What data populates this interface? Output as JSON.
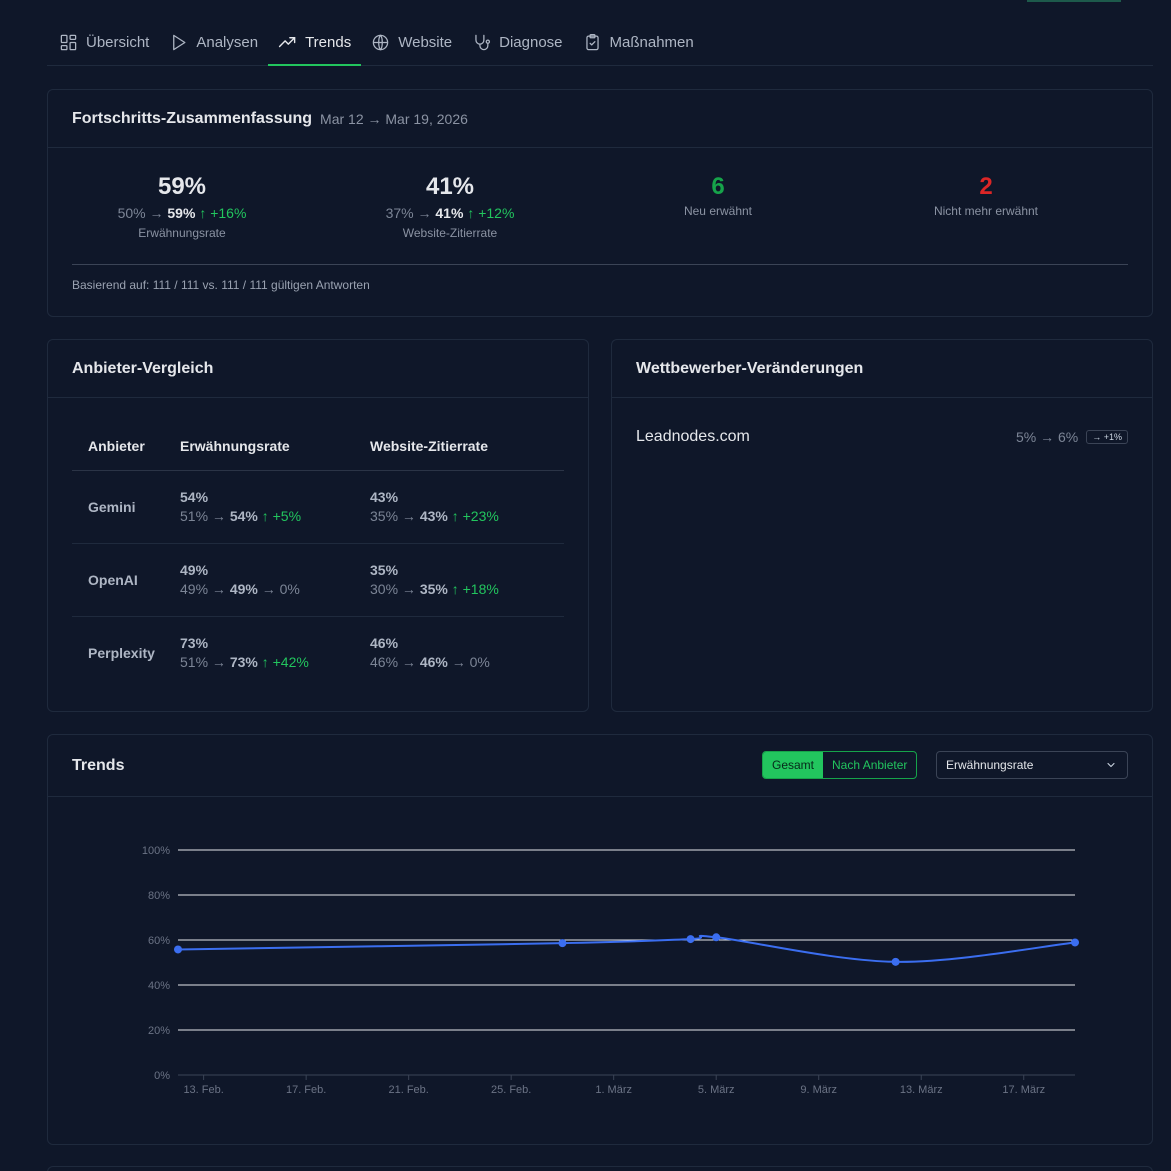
{
  "tabs": [
    {
      "label": "Übersicht",
      "icon": "dashboard-icon"
    },
    {
      "label": "Analysen",
      "icon": "play-icon"
    },
    {
      "label": "Trends",
      "icon": "trending-up-icon",
      "active": true
    },
    {
      "label": "Website",
      "icon": "globe-icon"
    },
    {
      "label": "Diagnose",
      "icon": "stethoscope-icon"
    },
    {
      "label": "Maßnahmen",
      "icon": "clipboard-check-icon"
    }
  ],
  "summary": {
    "title": "Fortschritts-Zusammenfassung",
    "range": "Mar 12 → Mar 19, 2026",
    "mention": {
      "value": "59%",
      "from": "50%",
      "to": "59%",
      "delta": "↑ +16%",
      "caption": "Erwähnungsrate"
    },
    "citation": {
      "value": "41%",
      "from": "37%",
      "to": "41%",
      "delta": "↑ +12%",
      "caption": "Website-Zitierrate"
    },
    "new_mentioned": {
      "value": "6",
      "caption": "Neu erwähnt"
    },
    "no_longer": {
      "value": "2",
      "caption": "Nicht mehr erwähnt"
    },
    "footnote": "Basierend auf: 111 / 111 vs. 111 / 111 gültigen Antworten"
  },
  "providers": {
    "title": "Anbieter-Vergleich",
    "headers": [
      "Anbieter",
      "Erwähnungsrate",
      "Website-Zitierrate"
    ],
    "rows": [
      {
        "name": "Gemini",
        "m": {
          "value": "54%",
          "from": "51%",
          "to": "54%",
          "delta": "↑ +5%"
        },
        "c": {
          "value": "43%",
          "from": "35%",
          "to": "43%",
          "delta": "↑ +23%"
        }
      },
      {
        "name": "OpenAI",
        "m": {
          "value": "49%",
          "from": "49%",
          "to": "49%",
          "delta": "→ 0%"
        },
        "c": {
          "value": "35%",
          "from": "30%",
          "to": "35%",
          "delta": "↑ +18%"
        }
      },
      {
        "name": "Perplexity",
        "m": {
          "value": "73%",
          "from": "51%",
          "to": "73%",
          "delta": "↑ +42%"
        },
        "c": {
          "value": "46%",
          "from": "46%",
          "to": "46%",
          "delta": "→ 0%"
        }
      }
    ]
  },
  "competitors": {
    "title": "Wettbewerber-Veränderungen",
    "items": [
      {
        "name": "Leadnodes.com",
        "change": "5% → 6%",
        "badge": "→ +1%"
      }
    ]
  },
  "trends": {
    "title": "Trends",
    "toggle_total": "Gesamt",
    "toggle_provider": "Nach Anbieter",
    "metric_select": "Erwähnungsrate"
  },
  "chart_data": {
    "type": "line",
    "title": "",
    "xlabel": "",
    "ylabel": "",
    "x_ticks": [
      "13. Feb.",
      "17. Feb.",
      "21. Feb.",
      "25. Feb.",
      "1. März",
      "5. März",
      "9. März",
      "13. März",
      "17. März"
    ],
    "y_ticks": [
      "0%",
      "20%",
      "40%",
      "60%",
      "80%",
      "100%"
    ],
    "ylim": [
      0,
      100
    ],
    "grid": true,
    "series": [
      {
        "color": "#3b6ef0",
        "x": [
          "2026-02-12",
          "2026-02-27",
          "2026-03-04",
          "2026-03-05",
          "2026-03-12",
          "2026-03-19"
        ],
        "values": [
          55.8,
          58.6,
          60.4,
          61.2,
          50.3,
          58.9
        ]
      }
    ]
  }
}
